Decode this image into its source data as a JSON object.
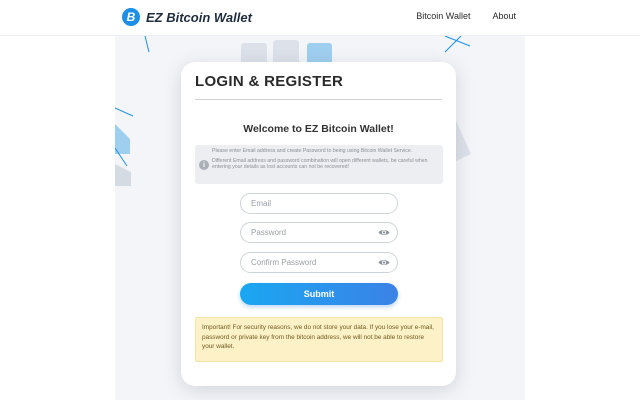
{
  "header": {
    "brand_logo_glyph": "B",
    "brand_name": "EZ Bitcoin Wallet",
    "nav": [
      {
        "label": "Bitcoin Wallet"
      },
      {
        "label": "About"
      }
    ]
  },
  "card": {
    "title": "LOGIN & REGISTER",
    "welcome": "Welcome to EZ Bitcoin Wallet!",
    "info": {
      "icon": "info-icon",
      "line1": "Please enter Email address and create Password to being using Bitcoin Wallet Service.",
      "line2": "Different Email address and password combination will open different wallets, be careful when entering your details as lost accounts can not be recovered!"
    },
    "form": {
      "email_placeholder": "Email",
      "email_value": "",
      "password_placeholder": "Password",
      "password_value": "",
      "confirm_placeholder": "Confirm Password",
      "confirm_value": "",
      "submit_label": "Submit"
    },
    "notice": "Important! For security reasons, we do not store your data. If you lose your e-mail, password or private key from the bitcoin address, we will not be able to restore your wallet."
  },
  "colors": {
    "accent": "#1c8fe6",
    "submit_gradient_start": "#1aa7f2",
    "submit_gradient_end": "#3b82e6",
    "notice_background": "#fdf1c7",
    "hero_background": "#f3f5f8"
  }
}
